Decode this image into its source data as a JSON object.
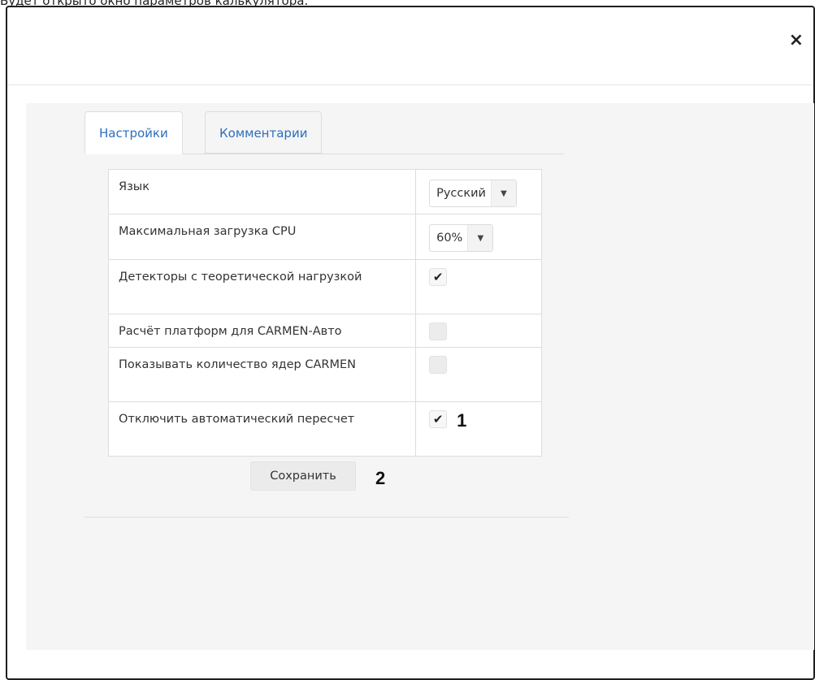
{
  "caption": "Будет открыто окно параметров калькулятора.",
  "modal": {
    "close_icon": "×"
  },
  "tabs": [
    {
      "label": "Настройки",
      "active": true
    },
    {
      "label": "Комментарии",
      "active": false
    }
  ],
  "settings": {
    "language": {
      "label": "Язык",
      "value": "Русский"
    },
    "cpu": {
      "label": "Максимальная загрузка CPU",
      "value": "60%"
    },
    "theoretical_detectors": {
      "label": "Детекторы с теоретической нагрузкой",
      "checked": true,
      "mark": "✔"
    },
    "carmen_auto": {
      "label": "Расчёт платформ для CARMEN-Авто",
      "checked": false,
      "mark": ""
    },
    "show_cores": {
      "label": "Показывать количество ядер CARMEN",
      "checked": false,
      "mark": ""
    },
    "disable_recalc": {
      "label": "Отключить автоматический пересчет",
      "checked": true,
      "mark": "✔"
    }
  },
  "caret_icon": "▼",
  "save_label": "Сохранить",
  "annotations": {
    "one": "1",
    "two": "2"
  }
}
